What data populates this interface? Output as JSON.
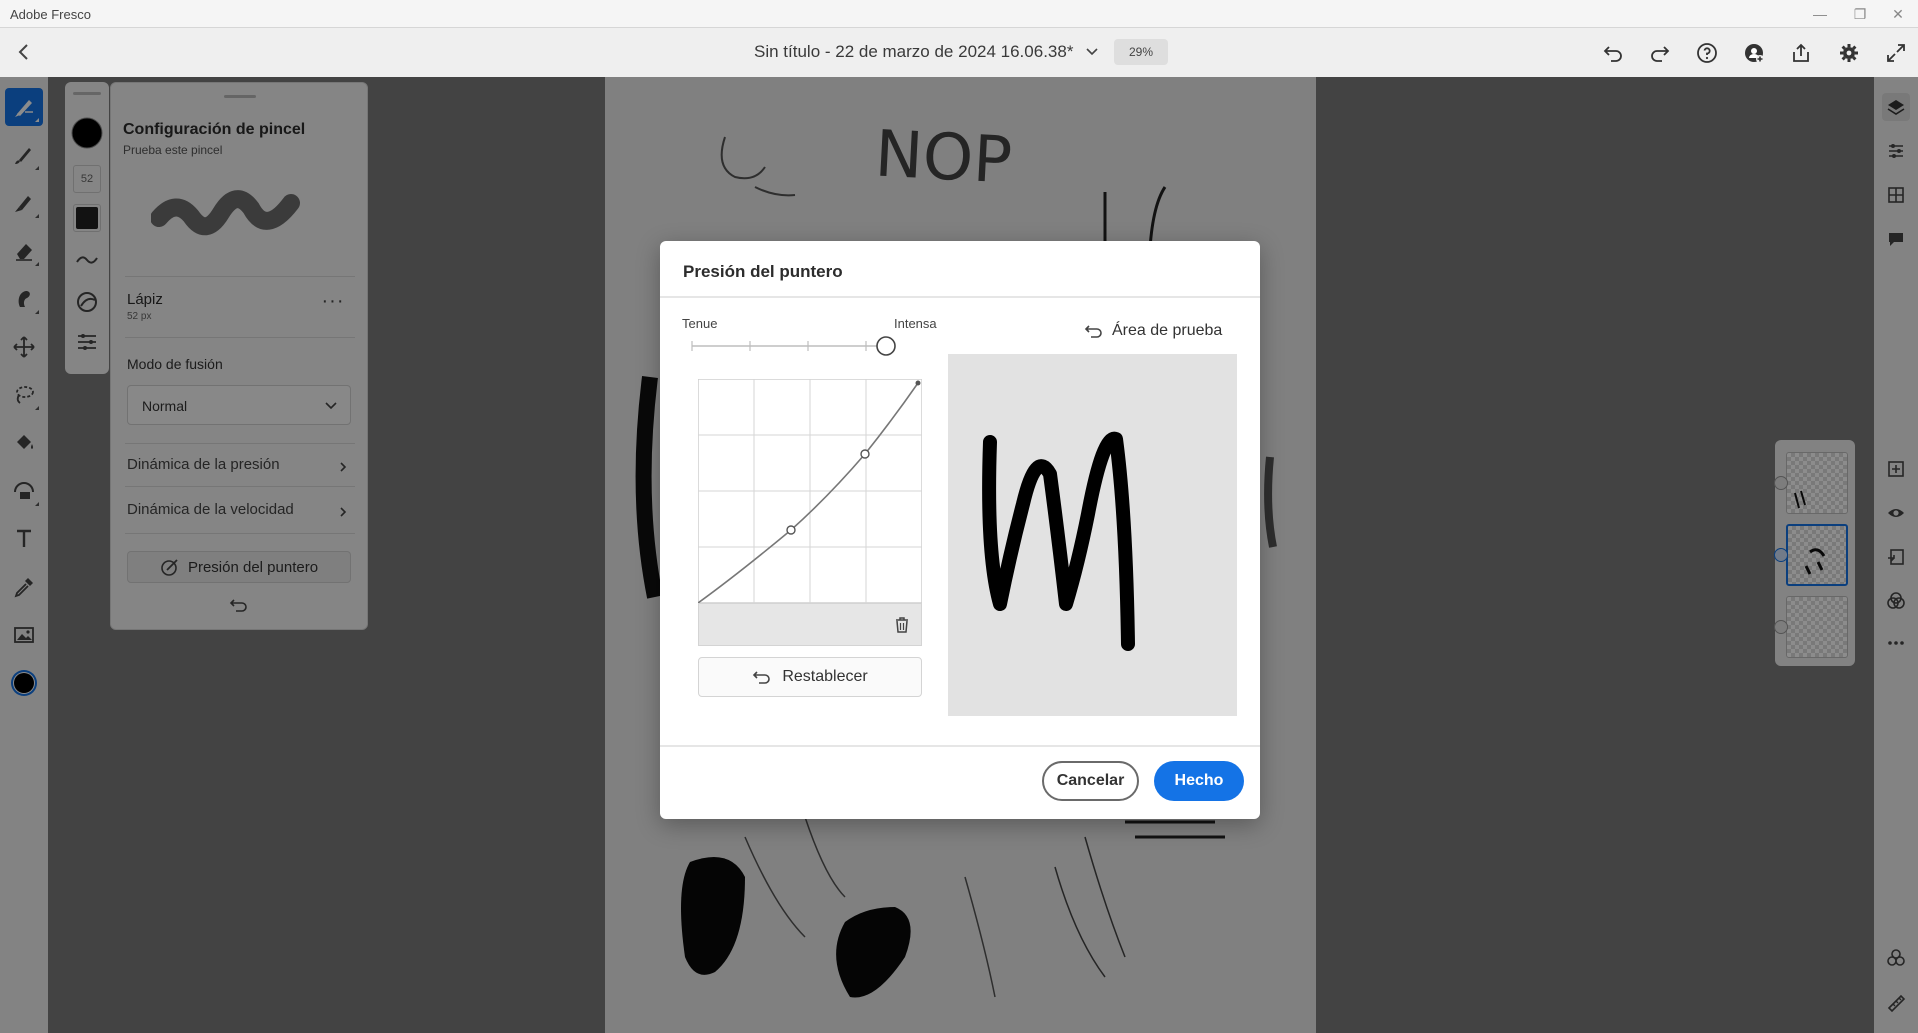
{
  "app": {
    "name": "Adobe Fresco"
  },
  "header": {
    "document_title": "Sin título - 22 de marzo de 2024 16.06.38*",
    "zoom": "29%"
  },
  "brush_panel": {
    "title": "Configuración de pincel",
    "subtitle": "Prueba este pincel",
    "brush_name": "Lápiz",
    "brush_size": "52 px",
    "size_badge": "52",
    "blend_mode_label": "Modo de fusión",
    "blend_mode_value": "Normal",
    "pressure_dynamics": "Dinámica de la presión",
    "velocity_dynamics": "Dinámica de la velocidad",
    "pointer_pressure_button": "Presión del puntero"
  },
  "dialog": {
    "title": "Presión del puntero",
    "soft_label": "Tenue",
    "hard_label": "Intensa",
    "slider_value": 1.0,
    "test_area_label": "Área de prueba",
    "reset_label": "Restablecer",
    "cancel_label": "Cancelar",
    "done_label": "Hecho"
  },
  "colors": {
    "accent": "#1473e6",
    "current_color": "#000000"
  }
}
